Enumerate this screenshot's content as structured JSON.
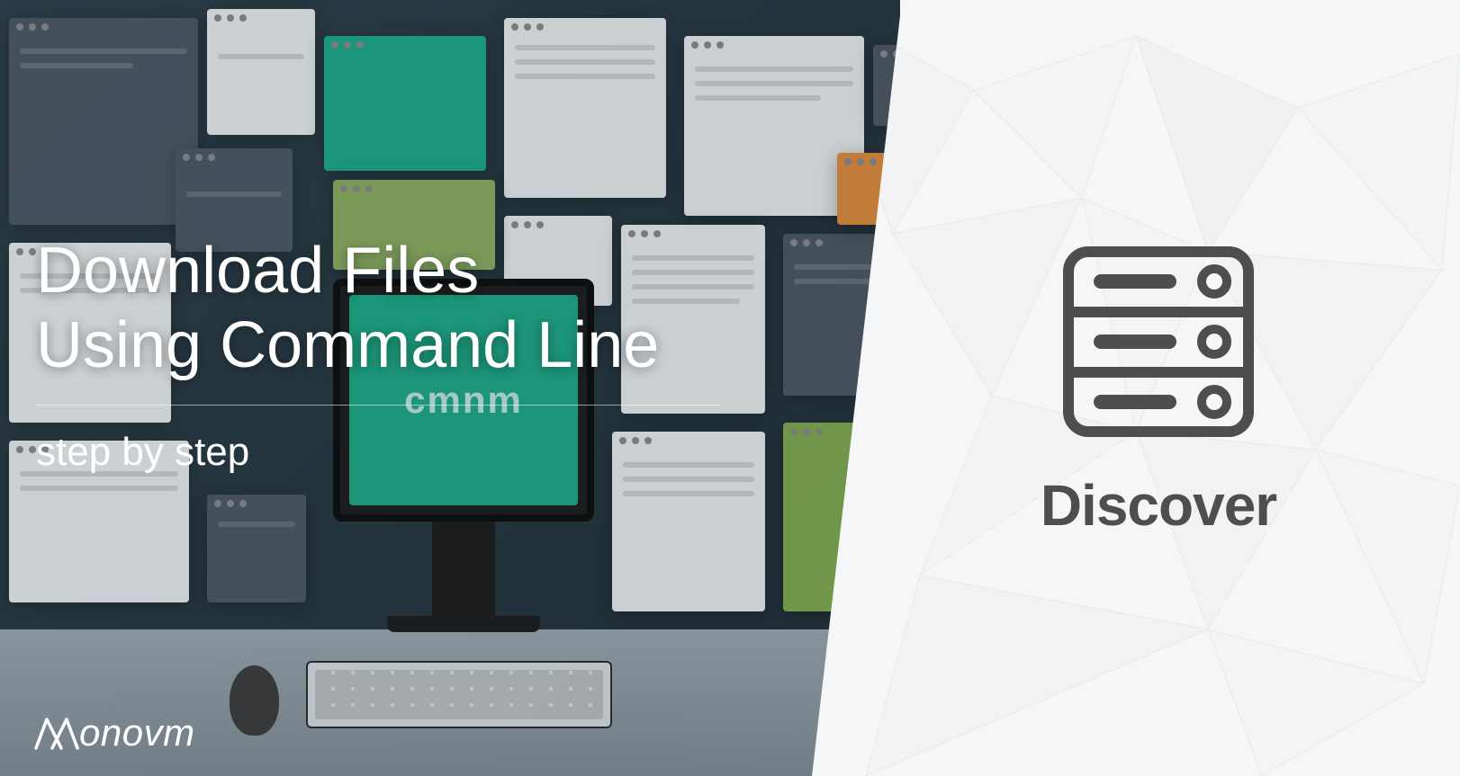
{
  "left": {
    "title": "Download Files\nUsing Command Line",
    "subtitle": "step by step",
    "monitor_text": "cmnm",
    "logo_text": "onovm"
  },
  "right": {
    "label": "Discover",
    "icon": "server-icon"
  },
  "colors": {
    "accent": "#1ba784",
    "text_light": "#ffffff",
    "text_dark": "#4e4e4e"
  }
}
